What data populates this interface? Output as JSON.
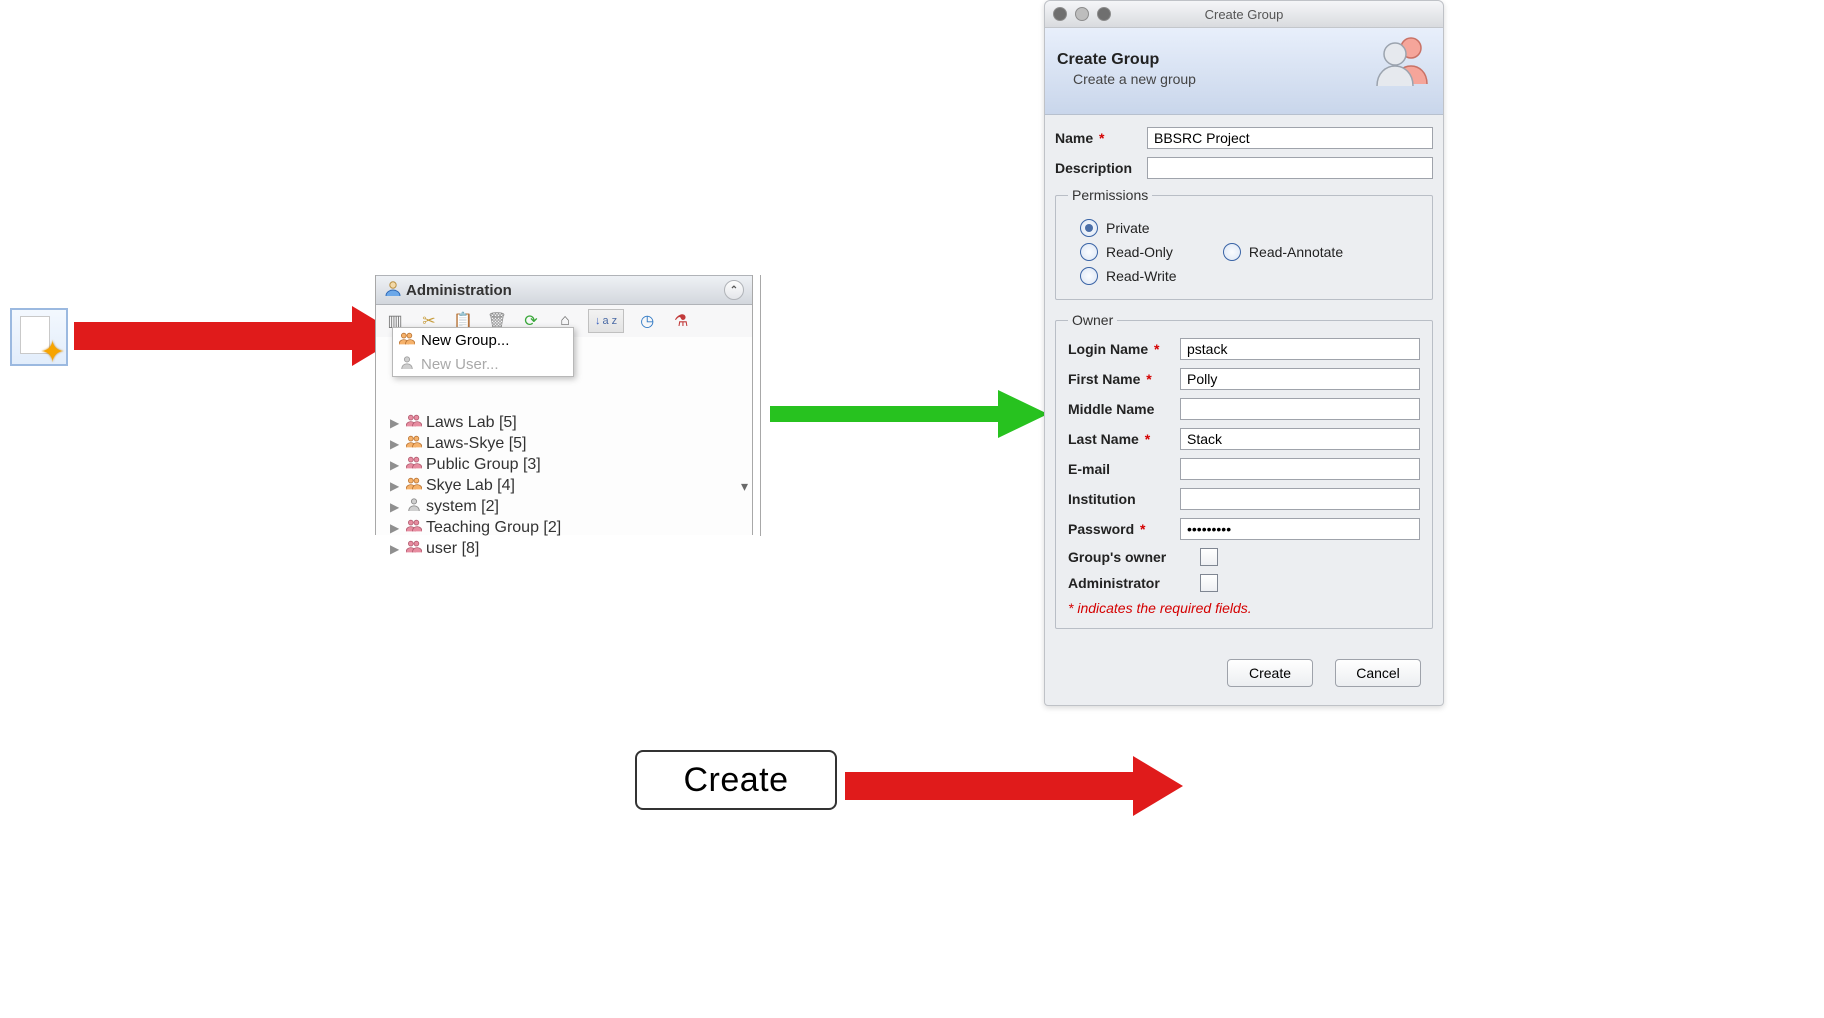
{
  "icon_button": {
    "name": "new-item"
  },
  "admin_panel": {
    "title": "Administration",
    "toolbar": {
      "sort_label": "a z"
    },
    "menu": {
      "new_group": "New Group...",
      "new_user": "New User..."
    },
    "groups": [
      {
        "label": "Laws Lab [5]"
      },
      {
        "label": "Laws-Skye [5]"
      },
      {
        "label": "Public Group [3]"
      },
      {
        "label": "Skye Lab [4]"
      },
      {
        "label": "system [2]"
      },
      {
        "label": "Teaching Group [2]"
      },
      {
        "label": "user [8]"
      }
    ]
  },
  "create_callout": "Create",
  "dialog": {
    "window_title": "Create Group",
    "header_title": "Create Group",
    "header_sub": "Create a new group",
    "fields": {
      "name_label": "Name",
      "name_value": "BBSRC Project",
      "description_label": "Description",
      "description_value": ""
    },
    "permissions": {
      "legend": "Permissions",
      "private": "Private",
      "read_only": "Read-Only",
      "read_annotate": "Read-Annotate",
      "read_write": "Read-Write",
      "selected": "private"
    },
    "owner": {
      "legend": "Owner",
      "login_label": "Login Name",
      "login_value": "pstack",
      "first_label": "First Name",
      "first_value": "Polly",
      "middle_label": "Middle Name",
      "middle_value": "",
      "last_label": "Last Name",
      "last_value": "Stack",
      "email_label": "E-mail",
      "email_value": "",
      "institution_label": "Institution",
      "institution_value": "",
      "password_label": "Password",
      "password_value": "•••••••••",
      "group_owner_label": "Group's owner",
      "administrator_label": "Administrator",
      "required_note": "* indicates the required fields."
    },
    "buttons": {
      "create": "Create",
      "cancel": "Cancel"
    }
  }
}
